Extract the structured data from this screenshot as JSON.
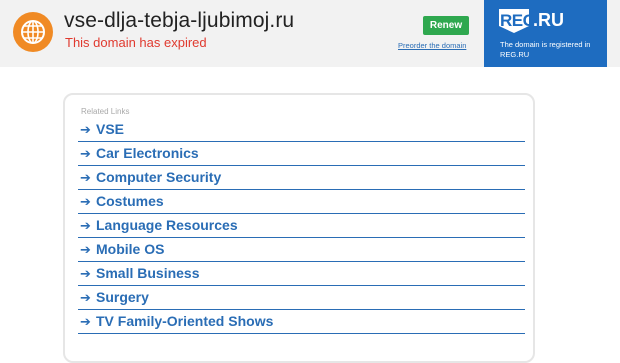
{
  "header": {
    "domain": "vse-dlja-tebja-ljubimoj.ru",
    "status": "This domain has expired",
    "renew_label": "Renew",
    "preorder_label": "Preorder the domain"
  },
  "registrar": {
    "logo_text": "REG",
    "logo_suffix": ".RU",
    "note": "The domain is registered in REG.RU"
  },
  "related": {
    "title": "Related Links",
    "items": [
      {
        "label": "VSE"
      },
      {
        "label": "Car Electronics"
      },
      {
        "label": "Computer Security"
      },
      {
        "label": "Costumes"
      },
      {
        "label": "Language Resources"
      },
      {
        "label": "Mobile OS"
      },
      {
        "label": "Small Business"
      },
      {
        "label": "Surgery"
      },
      {
        "label": "TV Family-Oriented Shows"
      }
    ]
  },
  "colors": {
    "accent_orange": "#f08a24",
    "expired_red": "#e03a2f",
    "renew_green": "#2fa84f",
    "link_blue": "#2a6db5",
    "reg_blue": "#1e6cc0"
  }
}
